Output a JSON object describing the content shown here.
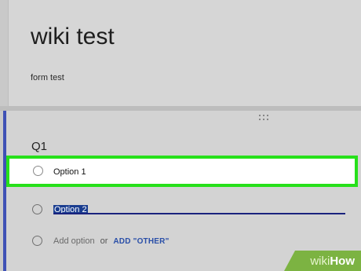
{
  "form": {
    "title": "wiki test",
    "description": "form test"
  },
  "question": {
    "title": "Q1",
    "options": [
      {
        "label": "Option 1"
      },
      {
        "label": "Option 2"
      }
    ],
    "add_option_label": "Add option",
    "or_label": "or",
    "add_other_label": "ADD \"OTHER\""
  },
  "watermark": {
    "prefix": "wiki",
    "suffix": "How"
  },
  "colors": {
    "accent": "#3f51b5",
    "highlight_border": "#26e01a",
    "selection_bg": "#1a3d8f",
    "add_other": "#2a4fa8"
  }
}
